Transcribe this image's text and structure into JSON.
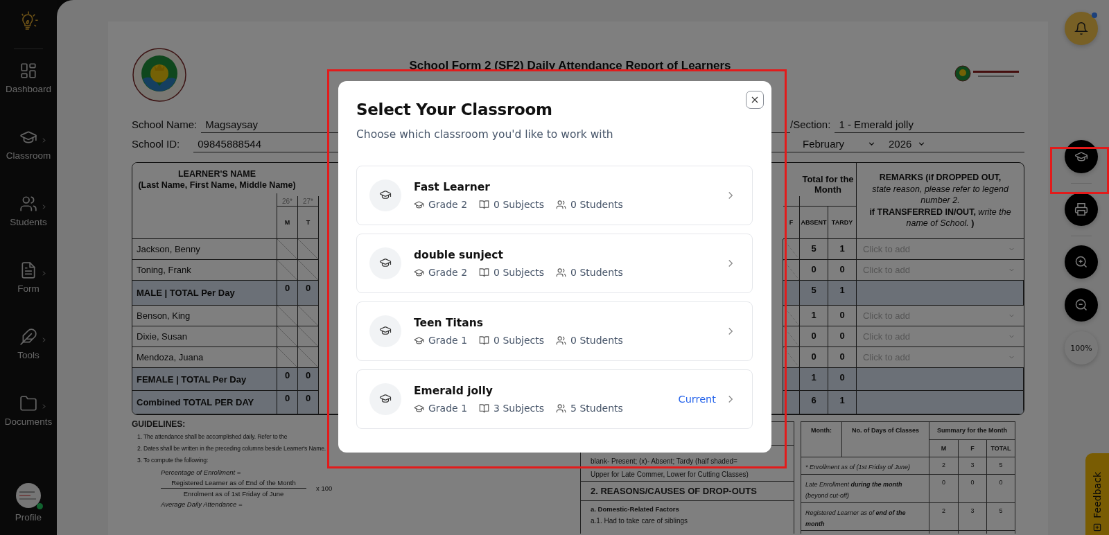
{
  "sidebar": {
    "items": [
      {
        "label": "Dashboard",
        "expandable": false
      },
      {
        "label": "Classroom",
        "expandable": true
      },
      {
        "label": "Students",
        "expandable": true
      },
      {
        "label": "Form",
        "expandable": true
      },
      {
        "label": "Tools",
        "expandable": true
      },
      {
        "label": "Documents",
        "expandable": true
      }
    ],
    "profile": {
      "label": "Profile",
      "online": true
    }
  },
  "document": {
    "title": "School Form 2 (SF2) Daily Attendance Report of Learners",
    "fields": [
      {
        "label": "School Name:",
        "value": "Magsaysay"
      },
      {
        "label": "School ID:",
        "value": "09845888544"
      }
    ],
    "section_field": {
      "label": "/Section:",
      "value": "1 - Emerald jolly"
    },
    "month_select": "February",
    "year_select": "2026",
    "table": {
      "name_header": [
        "LEARNER'S NAME",
        "(Last Name, First Name, Middle Name)"
      ],
      "dates": [
        "26*",
        "27*"
      ],
      "weekdays": [
        "M",
        "T"
      ],
      "last_weekday": "F",
      "total_header": "Total for the Month",
      "absent_header": "ABSENT",
      "tardy_header": "TARDY",
      "remarks_header": [
        "**REMARKS (if DROPPED OUT,** *state reason, please refer to legend number 2.*",
        "**if TRANSFERRED IN/OUT,** *write the name of School.* **)**"
      ],
      "rows": [
        {
          "kind": "learner",
          "name": "Jackson, Benny",
          "absent": "5",
          "tardy": "1",
          "remarks_placeholder": "Click to add"
        },
        {
          "kind": "learner",
          "name": "Toning, Frank",
          "absent": "0",
          "tardy": "0",
          "remarks_placeholder": "Click to add"
        },
        {
          "kind": "total",
          "name": "MALE | TOTAL Per Day",
          "days": [
            "0",
            "0"
          ],
          "absent": "5",
          "tardy": "1"
        },
        {
          "kind": "learner",
          "name": "Benson, King",
          "absent": "1",
          "tardy": "0",
          "remarks_placeholder": "Click to add"
        },
        {
          "kind": "learner",
          "name": "Dixie, Susan",
          "absent": "0",
          "tardy": "0",
          "remarks_placeholder": "Click to add"
        },
        {
          "kind": "learner",
          "name": "Mendoza, Juana",
          "absent": "0",
          "tardy": "0",
          "remarks_placeholder": "Click to add"
        },
        {
          "kind": "total",
          "name": "FEMALE | TOTAL Per Day",
          "days": [
            "0",
            "0"
          ],
          "absent": "1",
          "tardy": "0"
        },
        {
          "kind": "total",
          "name": "Combined TOTAL PER DAY",
          "days": [
            "0",
            "0"
          ],
          "absent": "6",
          "tardy": "1"
        }
      ]
    },
    "guidelines": {
      "title": "GUIDELINES:",
      "items": [
        "1. The attendance shall be accomplished daily. Refer to the",
        "2. Dates shall be written in the preceding columns beside Learner's Name.",
        "3. To compute the following:"
      ],
      "formula": {
        "label": "Percentage of Enrollment =",
        "numerator": "Registered Learner as of End of the Month",
        "denominator": "Enrolment as of 1st Friday of June",
        "multiplier": "x 100"
      },
      "next_formula": "Average Daily Attendance ="
    },
    "legend": {
      "lines": [
        "blank- Present; (x)- Absent; Tardy (half shaded=",
        "Upper for Late Commer, Lower for Cutting Classes)"
      ],
      "reasons_title": "2. REASONS/CAUSES OF DROP-OUTS",
      "factor_title": "a. Domestic-Related Factors",
      "factor_items": [
        "a.1. Had to take care of siblings"
      ]
    },
    "summary": {
      "month_header": "Month:",
      "days_header": "No. of Days of Classes",
      "summary_header": "Summary for the Month",
      "m_header": "M",
      "f_header": "F",
      "total_header": "TOTAL",
      "rows": [
        {
          "label": "* Enrollment as of (1st Friday of June)",
          "m": "2",
          "f": "3",
          "total": "5"
        },
        {
          "label": "Late Enrollment **during the month** (beyond cut-off)",
          "m": "0",
          "f": "0",
          "total": "0"
        },
        {
          "label": "Registered Learner as of **end of the month**",
          "m": "2",
          "f": "3",
          "total": "5"
        }
      ]
    }
  },
  "right_rail": {
    "notification_dot": true,
    "zoom_label": "100%"
  },
  "feedback": {
    "label": "Feedback"
  },
  "modal": {
    "title": "Select Your Classroom",
    "subtitle": "Choose which classroom you'd like to work with",
    "current_label": "Current",
    "classrooms": [
      {
        "name": "Fast Learner",
        "grade": "Grade 2",
        "subjects": "0 Subjects",
        "students": "0 Students",
        "current": false
      },
      {
        "name": "double sunject",
        "grade": "Grade 2",
        "subjects": "0 Subjects",
        "students": "0 Students",
        "current": false
      },
      {
        "name": "Teen Titans",
        "grade": "Grade 1",
        "subjects": "0 Subjects",
        "students": "0 Students",
        "current": false
      },
      {
        "name": "Emerald jolly",
        "grade": "Grade 1",
        "subjects": "3 Subjects",
        "students": "5 Students",
        "current": true
      }
    ]
  },
  "highlights": {
    "modal": true,
    "classroom_button": true
  }
}
